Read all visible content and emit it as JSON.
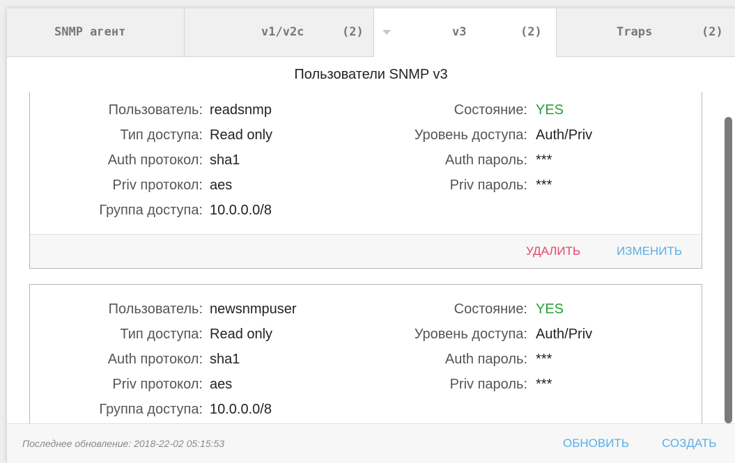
{
  "tabs": [
    {
      "label": "SNMP агент",
      "count": ""
    },
    {
      "label": "v1/v2c",
      "count": "(2)"
    },
    {
      "label": "v3",
      "count": "(2)",
      "active": true
    },
    {
      "label": "Traps",
      "count": "(2)"
    }
  ],
  "section_title": "Пользователи SNMP v3",
  "users": [
    {
      "user_label": "Пользователь:",
      "user": "readsnmp",
      "access_type_label": "Тип доступа:",
      "access_type": "Read only",
      "auth_proto_label": "Auth протокол:",
      "auth_proto": "sha1",
      "priv_proto_label": "Priv протокол:",
      "priv_proto": "aes",
      "group_label": "Группа доступа:",
      "group": "10.0.0.0/8",
      "state_label": "Состояние:",
      "state": "YES",
      "level_label": "Уровень доступа:",
      "level": "Auth/Priv",
      "auth_pass_label": "Auth пароль:",
      "auth_pass": "***",
      "priv_pass_label": "Priv пароль:",
      "priv_pass": "***",
      "delete_label": "УДАЛИТЬ",
      "edit_label": "ИЗМЕНИТЬ"
    },
    {
      "user_label": "Пользователь:",
      "user": "newsnmpuser",
      "access_type_label": "Тип доступа:",
      "access_type": "Read only",
      "auth_proto_label": "Auth протокол:",
      "auth_proto": "sha1",
      "priv_proto_label": "Priv протокол:",
      "priv_proto": "aes",
      "group_label": "Группа доступа:",
      "group": "10.0.0.0/8",
      "state_label": "Состояние:",
      "state": "YES",
      "level_label": "Уровень доступа:",
      "level": "Auth/Priv",
      "auth_pass_label": "Auth пароль:",
      "auth_pass": "***",
      "priv_pass_label": "Priv пароль:",
      "priv_pass": "***"
    }
  ],
  "footer": {
    "last_update": "Последнее обновление: 2018-22-02 05:15:53",
    "refresh_label": "ОБНОВИТЬ",
    "create_label": "СОЗДАТЬ"
  },
  "colors": {
    "accent_blue": "#5aaee6",
    "delete_pink": "#e8436f",
    "status_green": "#2a9d3a"
  }
}
